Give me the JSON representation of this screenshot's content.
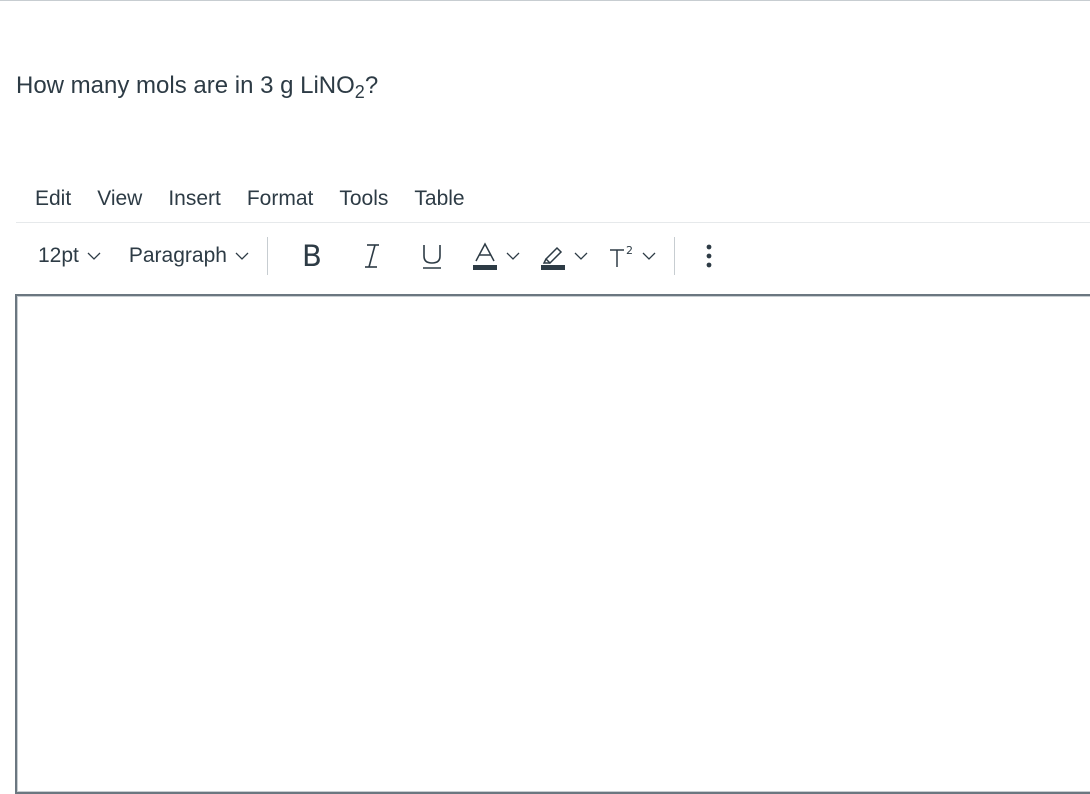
{
  "question": {
    "prefix": "How many mols are in 3 g LiNO",
    "subscript": "2",
    "suffix": "?"
  },
  "menubar": {
    "items": [
      "Edit",
      "View",
      "Insert",
      "Format",
      "Tools",
      "Table"
    ]
  },
  "toolbar": {
    "font_size": "12pt",
    "block_format": "Paragraph",
    "bold_label": "B",
    "italic_label": "I",
    "underline_label": "U",
    "text_color_label": "A",
    "superscript_label": "T²",
    "icons": {
      "text_color": "text-color-icon",
      "highlight": "highlight-pen-icon",
      "more": "more-vertical-icon"
    }
  },
  "colors": {
    "text": "#2d3b45",
    "border": "#6b7780",
    "divider": "#c7cdd1"
  }
}
